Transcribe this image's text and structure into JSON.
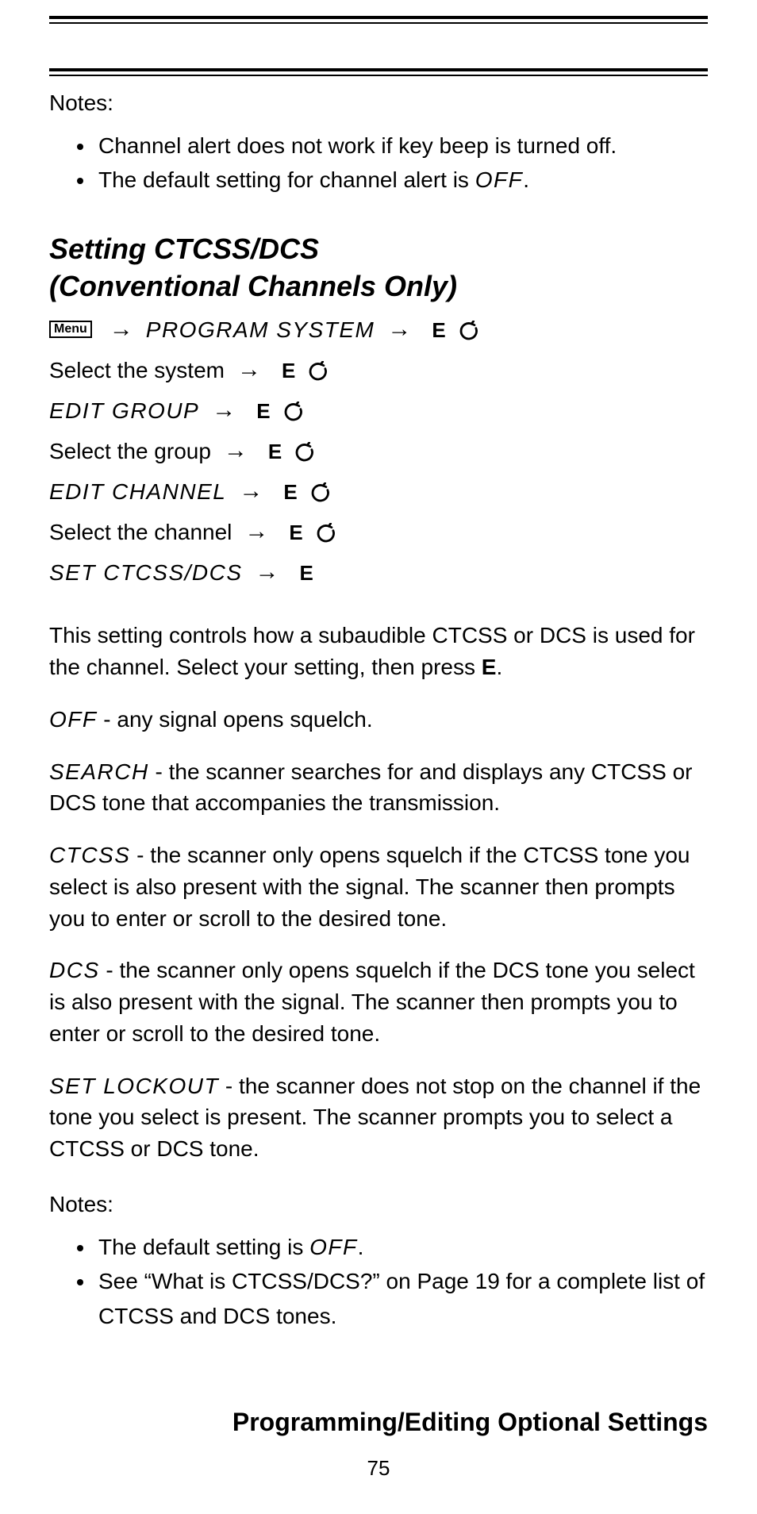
{
  "notes1": {
    "label": "Notes:",
    "items": [
      "Channel alert does not work if key beep is turned off.",
      {
        "pre": "The default setting for channel alert is ",
        "seg": "OFF",
        "post": "."
      }
    ]
  },
  "heading": {
    "line1": "Setting CTCSS/DCS",
    "line2": "(Conventional Channels Only)"
  },
  "nav": {
    "menu_label": "Menu",
    "e_label": "E",
    "lines": [
      {
        "menu": true,
        "seg": "PROGRAM SYSTEM",
        "e": true,
        "scroll": true
      },
      {
        "text": "Select the system",
        "e": true,
        "scroll": true
      },
      {
        "seg": "EDIT GROUP",
        "e": true,
        "scroll": true
      },
      {
        "text": "Select the group",
        "e": true,
        "scroll": true
      },
      {
        "seg": "EDIT CHANNEL",
        "e": true,
        "scroll": true
      },
      {
        "text": "Select the channel",
        "e": true,
        "scroll": true
      },
      {
        "seg": "SET CTCSS/DCS",
        "e": true,
        "scroll": false
      }
    ]
  },
  "intro": {
    "pre": "This setting controls how a subaudible CTCSS or DCS is used for the channel. Select your setting, then press ",
    "e": "E",
    "post": "."
  },
  "options": [
    {
      "seg": "OFF",
      "text": " - any signal opens squelch."
    },
    {
      "seg": "SEARCH",
      "text": " - the scanner searches for and displays any CTCSS or DCS tone that accompanies the transmission."
    },
    {
      "seg": "CTCSS",
      "text": " - the scanner only opens squelch if the CTCSS tone you select is also present with the signal. The scanner then prompts you to enter or scroll to the desired tone."
    },
    {
      "seg": "DCS",
      "text": " - the scanner only opens squelch if the DCS tone you select is also present with the signal. The scanner then prompts you to enter or scroll to the desired tone."
    },
    {
      "seg": "SET LOCKOUT",
      "text": " - the scanner does not stop on the channel if the tone you select is present. The scanner prompts you to select a CTCSS or DCS tone."
    }
  ],
  "notes2": {
    "label": "Notes:",
    "items": [
      {
        "pre": "The default setting is ",
        "seg": "OFF",
        "post": "."
      },
      "See “What is CTCSS/DCS?” on Page 19 for a complete list of CTCSS and DCS tones."
    ]
  },
  "footer": {
    "title": "Programming/Editing Optional Settings",
    "page": "75"
  }
}
